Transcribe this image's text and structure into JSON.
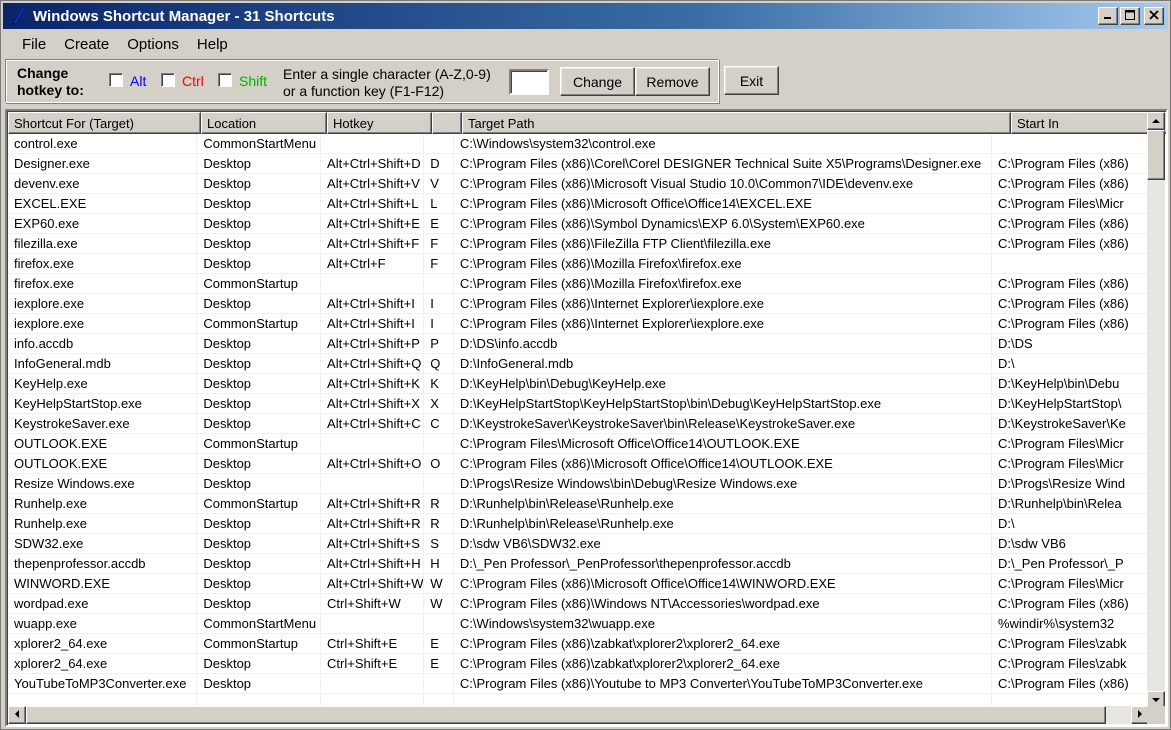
{
  "window": {
    "title": "Windows Shortcut Manager - 31 Shortcuts",
    "minimize": "_",
    "maximize": "□",
    "close": "✕"
  },
  "menu": [
    "File",
    "Create",
    "Options",
    "Help"
  ],
  "hotkey": {
    "label_line1": "Change",
    "label_line2": "hotkey to:",
    "alt": "Alt",
    "ctrl": "Ctrl",
    "shift": "Shift",
    "alt_color": "#0000ff",
    "ctrl_color": "#ff0000",
    "shift_color": "#00b000",
    "help_line1": "Enter a single character (A-Z,0-9)",
    "help_line2": "or a function key (F1-F12)",
    "char_value": "",
    "change_button": "Change",
    "remove_button": "Remove",
    "exit_button": "Exit"
  },
  "table": {
    "columns": [
      "Shortcut For (Target)",
      "Location",
      "Hotkey",
      "",
      "Target Path",
      "Start In"
    ],
    "rows": [
      [
        "control.exe",
        "CommonStartMenu",
        "",
        "",
        "C:\\Windows\\system32\\control.exe",
        ""
      ],
      [
        "Designer.exe",
        "Desktop",
        "Alt+Ctrl+Shift+D",
        "D",
        "C:\\Program Files (x86)\\Corel\\Corel DESIGNER Technical Suite X5\\Programs\\Designer.exe",
        "C:\\Program Files (x86)"
      ],
      [
        "devenv.exe",
        "Desktop",
        "Alt+Ctrl+Shift+V",
        "V",
        "C:\\Program Files (x86)\\Microsoft Visual Studio 10.0\\Common7\\IDE\\devenv.exe",
        "C:\\Program Files (x86)"
      ],
      [
        "EXCEL.EXE",
        "Desktop",
        "Alt+Ctrl+Shift+L",
        "L",
        "C:\\Program Files (x86)\\Microsoft Office\\Office14\\EXCEL.EXE",
        "C:\\Program Files\\Micr"
      ],
      [
        "EXP60.exe",
        "Desktop",
        "Alt+Ctrl+Shift+E",
        "E",
        "C:\\Program Files (x86)\\Symbol Dynamics\\EXP 6.0\\System\\EXP60.exe",
        "C:\\Program Files (x86)"
      ],
      [
        "filezilla.exe",
        "Desktop",
        "Alt+Ctrl+Shift+F",
        "F",
        "C:\\Program Files (x86)\\FileZilla FTP Client\\filezilla.exe",
        "C:\\Program Files (x86)"
      ],
      [
        "firefox.exe",
        "Desktop",
        "Alt+Ctrl+F",
        "F",
        "C:\\Program Files (x86)\\Mozilla Firefox\\firefox.exe",
        ""
      ],
      [
        "firefox.exe",
        "CommonStartup",
        "",
        "",
        "C:\\Program Files (x86)\\Mozilla Firefox\\firefox.exe",
        "C:\\Program Files (x86)"
      ],
      [
        "iexplore.exe",
        "Desktop",
        "Alt+Ctrl+Shift+I",
        "I",
        "C:\\Program Files (x86)\\Internet Explorer\\iexplore.exe",
        "C:\\Program Files (x86)"
      ],
      [
        "iexplore.exe",
        "CommonStartup",
        "Alt+Ctrl+Shift+I",
        "I",
        "C:\\Program Files (x86)\\Internet Explorer\\iexplore.exe",
        "C:\\Program Files (x86)"
      ],
      [
        "info.accdb",
        "Desktop",
        "Alt+Ctrl+Shift+P",
        "P",
        "D:\\DS\\info.accdb",
        "D:\\DS"
      ],
      [
        "InfoGeneral.mdb",
        "Desktop",
        "Alt+Ctrl+Shift+Q",
        "Q",
        "D:\\InfoGeneral.mdb",
        "D:\\"
      ],
      [
        "KeyHelp.exe",
        "Desktop",
        "Alt+Ctrl+Shift+K",
        "K",
        "D:\\KeyHelp\\bin\\Debug\\KeyHelp.exe",
        "D:\\KeyHelp\\bin\\Debu"
      ],
      [
        "KeyHelpStartStop.exe",
        "Desktop",
        "Alt+Ctrl+Shift+X",
        "X",
        "D:\\KeyHelpStartStop\\KeyHelpStartStop\\bin\\Debug\\KeyHelpStartStop.exe",
        "D:\\KeyHelpStartStop\\"
      ],
      [
        "KeystrokeSaver.exe",
        "Desktop",
        "Alt+Ctrl+Shift+C",
        "C",
        "D:\\KeystrokeSaver\\KeystrokeSaver\\bin\\Release\\KeystrokeSaver.exe",
        "D:\\KeystrokeSaver\\Ke"
      ],
      [
        "OUTLOOK.EXE",
        "CommonStartup",
        "",
        "",
        "C:\\Program Files\\Microsoft Office\\Office14\\OUTLOOK.EXE",
        "C:\\Program Files\\Micr"
      ],
      [
        "OUTLOOK.EXE",
        "Desktop",
        "Alt+Ctrl+Shift+O",
        "O",
        "C:\\Program Files (x86)\\Microsoft Office\\Office14\\OUTLOOK.EXE",
        "C:\\Program Files\\Micr"
      ],
      [
        "Resize Windows.exe",
        "Desktop",
        "",
        "",
        "D:\\Progs\\Resize Windows\\bin\\Debug\\Resize Windows.exe",
        "D:\\Progs\\Resize Wind"
      ],
      [
        "Runhelp.exe",
        "CommonStartup",
        "Alt+Ctrl+Shift+R",
        "R",
        "D:\\Runhelp\\bin\\Release\\Runhelp.exe",
        "D:\\Runhelp\\bin\\Relea"
      ],
      [
        "Runhelp.exe",
        "Desktop",
        "Alt+Ctrl+Shift+R",
        "R",
        "D:\\Runhelp\\bin\\Release\\Runhelp.exe",
        "D:\\"
      ],
      [
        "SDW32.exe",
        "Desktop",
        "Alt+Ctrl+Shift+S",
        "S",
        "D:\\sdw VB6\\SDW32.exe",
        "D:\\sdw VB6"
      ],
      [
        "thepenprofessor.accdb",
        "Desktop",
        "Alt+Ctrl+Shift+H",
        "H",
        "D:\\_Pen Professor\\_PenProfessor\\thepenprofessor.accdb",
        "D:\\_Pen Professor\\_P"
      ],
      [
        "WINWORD.EXE",
        "Desktop",
        "Alt+Ctrl+Shift+W",
        "W",
        "C:\\Program Files (x86)\\Microsoft Office\\Office14\\WINWORD.EXE",
        "C:\\Program Files\\Micr"
      ],
      [
        "wordpad.exe",
        "Desktop",
        "Ctrl+Shift+W",
        "W",
        "C:\\Program Files (x86)\\Windows NT\\Accessories\\wordpad.exe",
        "C:\\Program Files (x86)"
      ],
      [
        "wuapp.exe",
        "CommonStartMenu",
        "",
        "",
        "C:\\Windows\\system32\\wuapp.exe",
        "%windir%\\system32"
      ],
      [
        "xplorer2_64.exe",
        "CommonStartup",
        "Ctrl+Shift+E",
        "E",
        "C:\\Program Files (x86)\\zabkat\\xplorer2\\xplorer2_64.exe",
        "C:\\Program Files\\zabk"
      ],
      [
        "xplorer2_64.exe",
        "Desktop",
        "Ctrl+Shift+E",
        "E",
        "C:\\Program Files (x86)\\zabkat\\xplorer2\\xplorer2_64.exe",
        "C:\\Program Files\\zabk"
      ],
      [
        "YouTubeToMP3Converter.exe",
        "Desktop",
        "",
        "",
        "C:\\Program Files (x86)\\Youtube to MP3 Converter\\YouTubeToMP3Converter.exe",
        "C:\\Program Files (x86)"
      ],
      [
        "",
        "",
        "",
        "",
        "",
        ""
      ]
    ]
  }
}
